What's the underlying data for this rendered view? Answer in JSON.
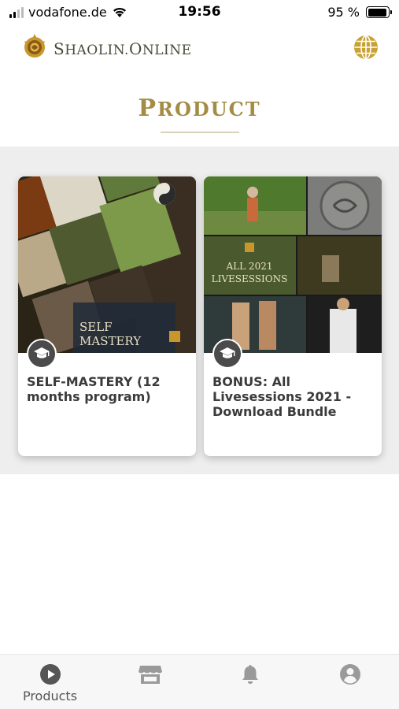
{
  "status_bar": {
    "carrier": "vodafone.de",
    "time": "19:56",
    "battery": "95 %",
    "battery_level": 0.95
  },
  "header": {
    "brand_first": "S",
    "brand_rest": "HAOLIN",
    "brand_dot": ".",
    "brand_second_first": "O",
    "brand_second_rest": "NLINE",
    "logo_icon": "shaolin-emblem-icon",
    "language_icon": "globe-icon"
  },
  "page": {
    "title_first": "P",
    "title_rest": "RODUCT"
  },
  "products": [
    {
      "title": "SELF-MASTERY (12 months program)",
      "image_text_line1": "SELF",
      "image_text_line2": "MASTERY",
      "badge_icon": "graduation-cap-icon"
    },
    {
      "title": "BONUS: All Livesessions 2021 - Download Bundle",
      "image_text_line1": "ALL 2021",
      "image_text_line2": "LIVESESSIONS",
      "badge_icon": "graduation-cap-icon"
    }
  ],
  "tab_bar": {
    "tabs": [
      {
        "label": "Products",
        "icon": "play-circle-icon",
        "active": true
      },
      {
        "label": "",
        "icon": "store-icon",
        "active": false
      },
      {
        "label": "",
        "icon": "bell-icon",
        "active": false
      },
      {
        "label": "",
        "icon": "user-circle-icon",
        "active": false
      }
    ]
  },
  "colors": {
    "accent_gold": "#a38c45",
    "section_bg": "#eeeeee",
    "tab_icon": "#9a9a9a",
    "active_tab_icon": "#555555"
  }
}
